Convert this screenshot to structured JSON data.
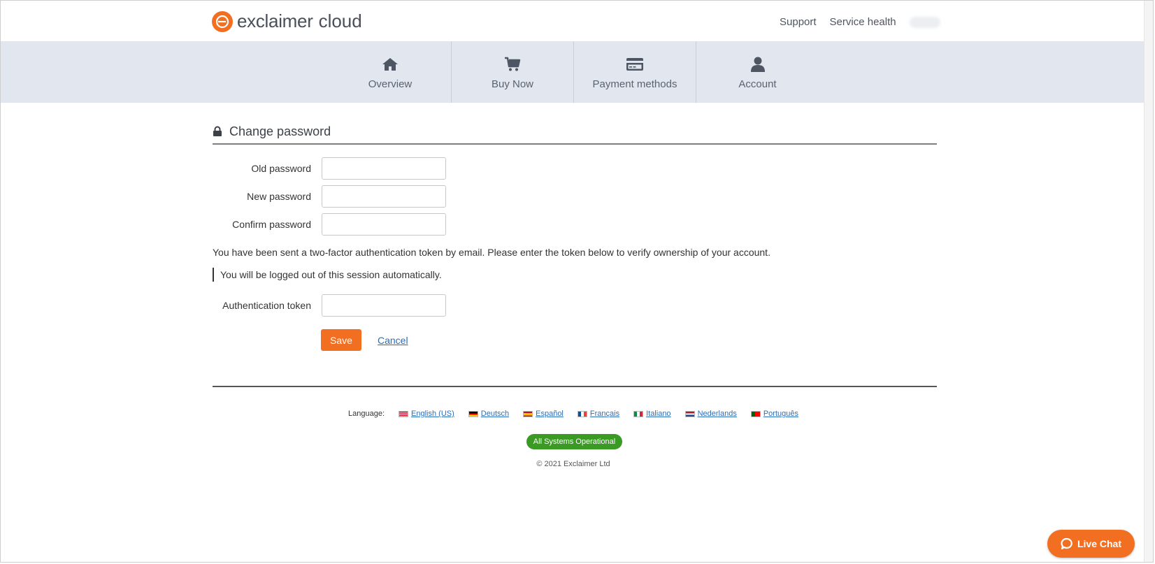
{
  "brand": {
    "name": "exclaimer",
    "product": "cloud",
    "accent": "#f26f21"
  },
  "top_links": {
    "support": "Support",
    "service_health": "Service health"
  },
  "nav": {
    "items": [
      {
        "label": "Overview",
        "icon": "home-icon"
      },
      {
        "label": "Buy Now",
        "icon": "cart-icon"
      },
      {
        "label": "Payment methods",
        "icon": "credit-card-icon"
      },
      {
        "label": "Account",
        "icon": "user-icon"
      }
    ]
  },
  "page": {
    "title": "Change password",
    "fields": {
      "old_password": {
        "label": "Old password",
        "value": ""
      },
      "new_password": {
        "label": "New password",
        "value": ""
      },
      "confirm_password": {
        "label": "Confirm password",
        "value": ""
      },
      "auth_token": {
        "label": "Authentication token",
        "value": ""
      }
    },
    "info_text": "You have been sent a two-factor authentication token by email. Please enter the token below to verify ownership of your account.",
    "note_text": "You will be logged out of this session automatically.",
    "save_label": "Save",
    "cancel_label": "Cancel"
  },
  "footer": {
    "language_label": "Language:",
    "languages": [
      "English (US)",
      "Deutsch",
      "Español",
      "Français",
      "Italiano",
      "Nederlands",
      "Português"
    ],
    "status": {
      "text": "All Systems Operational",
      "color": "#3a9a23"
    },
    "copyright": "© 2021 Exclaimer Ltd"
  },
  "live_chat": {
    "label": "Live Chat"
  }
}
